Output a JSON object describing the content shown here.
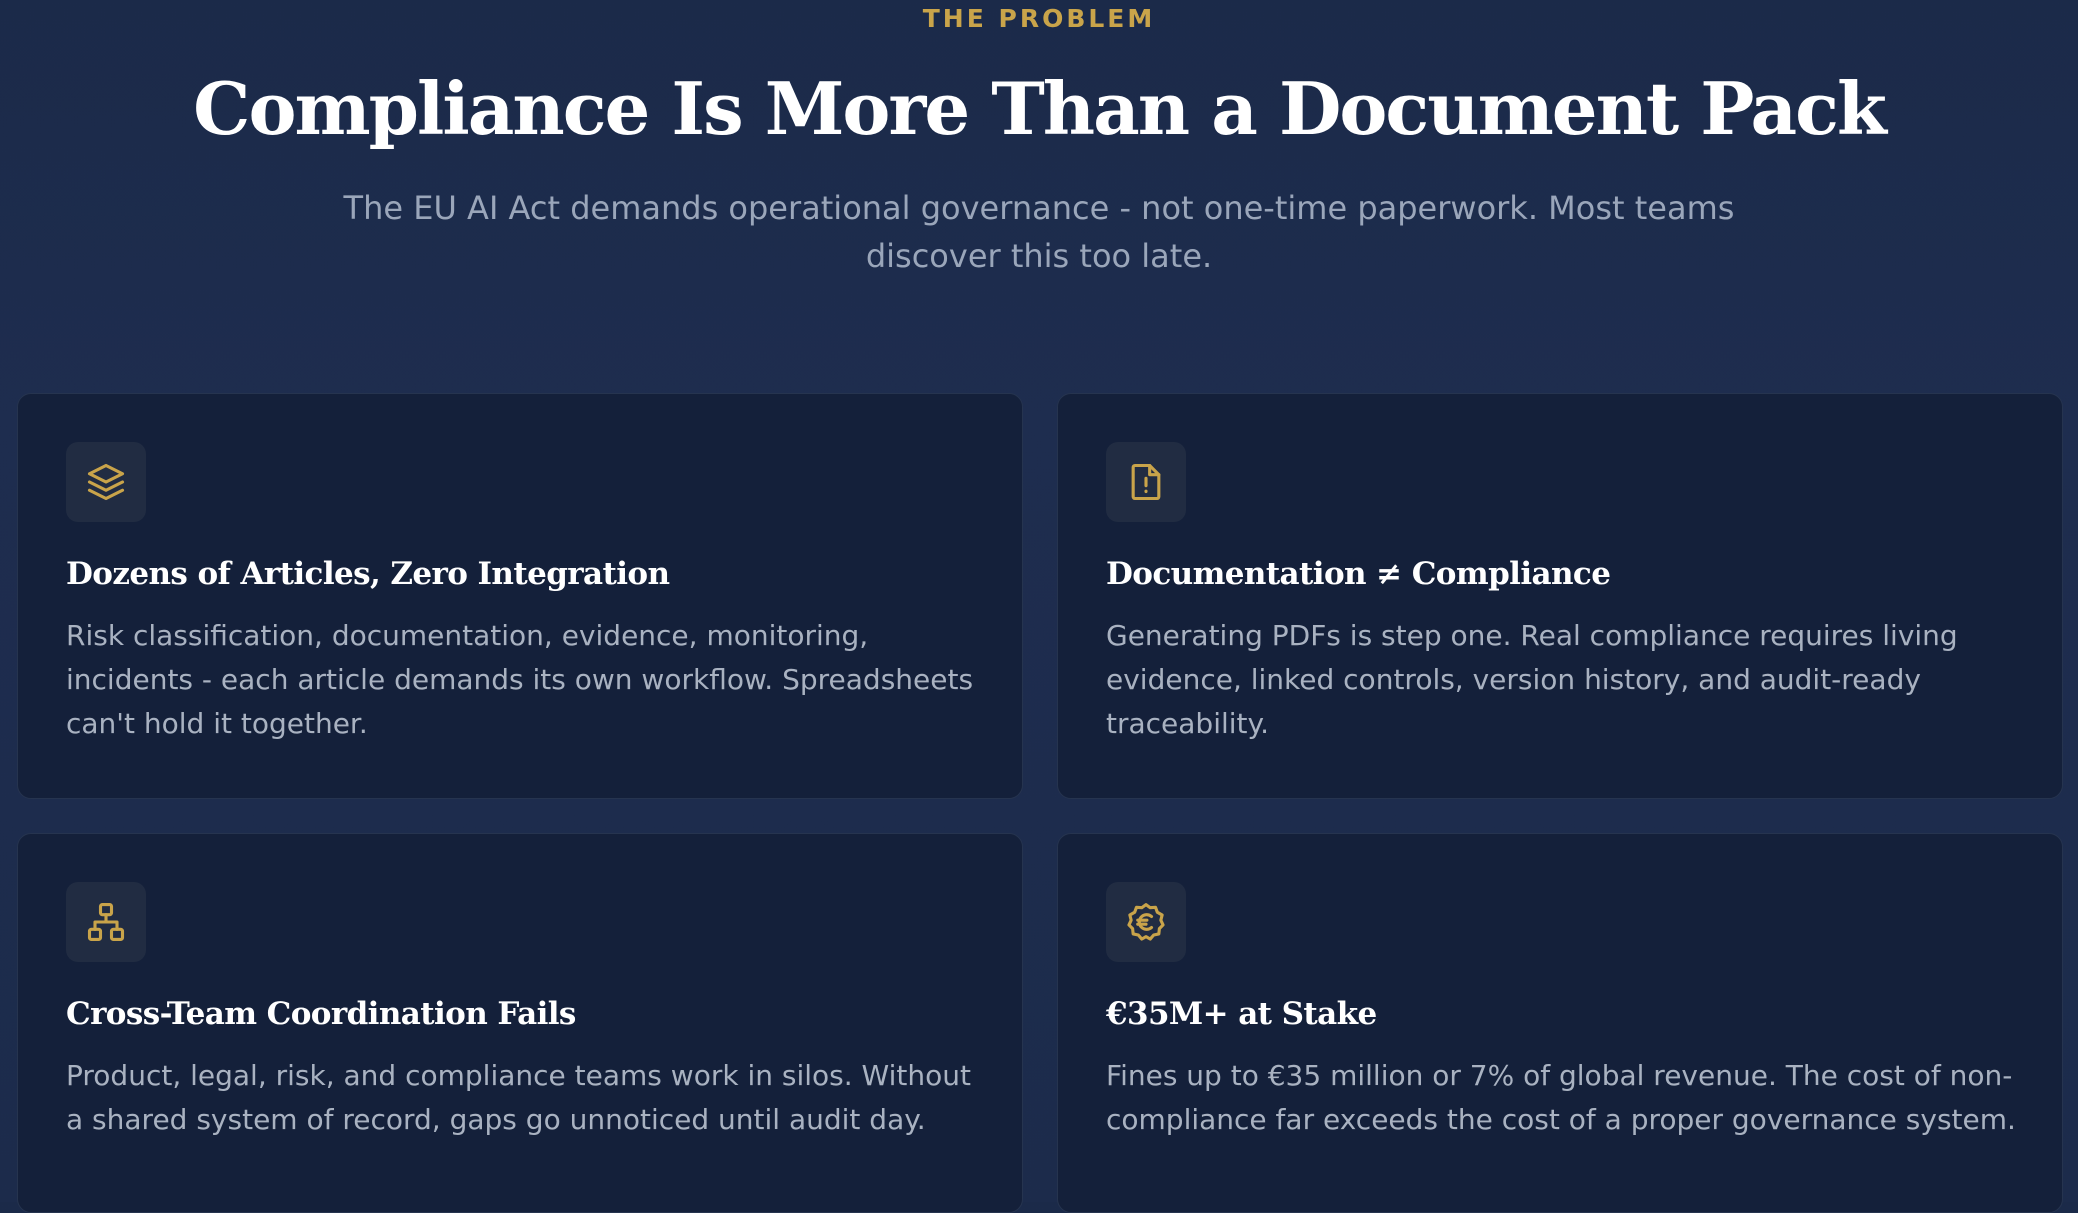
{
  "section": {
    "eyebrow": "THE PROBLEM",
    "title": "Compliance Is More Than a Document Pack",
    "subtitle": "The EU AI Act demands operational governance - not one-time paperwork. Most teams discover this too late."
  },
  "colors": {
    "background": "#1c2b4b",
    "card": "#14203a",
    "accent_gold": "#c9a44a",
    "title_text": "#ffffff",
    "body_text": "#a9b2c1"
  },
  "cards": [
    {
      "icon": "layers-icon",
      "title": "Dozens of Articles, Zero Integration",
      "body": "Risk classification, documentation, evidence, monitoring, incidents - each article demands its own workflow. Spreadsheets can't hold it together."
    },
    {
      "icon": "file-alert-icon",
      "title": "Documentation ≠ Compliance",
      "body": "Generating PDFs is step one. Real compliance requires living evidence, linked controls, version history, and audit-ready traceability."
    },
    {
      "icon": "network-icon",
      "title": "Cross-Team Coordination Fails",
      "body": "Product, legal, risk, and compliance teams work in silos. Without a shared system of record, gaps go unnoticed until audit day."
    },
    {
      "icon": "euro-badge-icon",
      "title": "€35M+ at Stake",
      "body": "Fines up to €35 million or 7% of global revenue. The cost of non-compliance far exceeds the cost of a proper governance system."
    }
  ]
}
